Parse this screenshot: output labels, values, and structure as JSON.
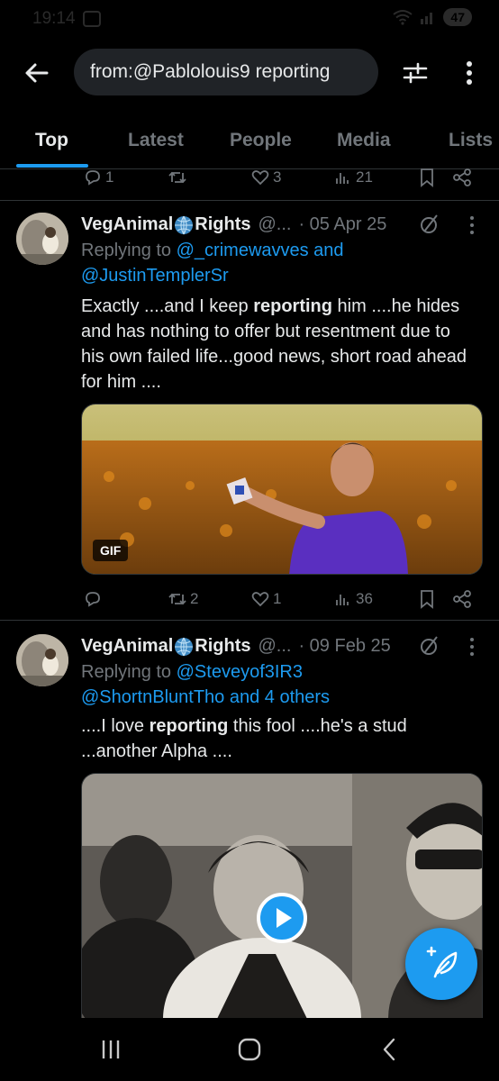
{
  "status": {
    "time": "19:14",
    "battery": "47"
  },
  "search": {
    "query": "from:@Pablolouis9 reporting"
  },
  "tabs": [
    {
      "label": "Top",
      "active": true
    },
    {
      "label": "Latest",
      "active": false
    },
    {
      "label": "People",
      "active": false
    },
    {
      "label": "Media",
      "active": false
    },
    {
      "label": "Lists",
      "active": false
    }
  ],
  "prev_tweet_actions": {
    "replies": "1",
    "retweets": "",
    "likes": "3",
    "views": "21"
  },
  "tweets": [
    {
      "name": "VegAnimal",
      "name_suffix": "Rights",
      "handle": "@...",
      "date": "· 05 Apr 25",
      "reply_prefix": "Replying to ",
      "reply_users": "@_crimewavves and @JustinTemplerSr",
      "text_before": "Exactly ....and I keep ",
      "text_bold": "reporting",
      "text_after": " him ....he hides and has nothing to offer but resentment due to his own failed life...good news, short road ahead for him ....",
      "media_badge": "GIF",
      "replies": "",
      "retweets": "2",
      "likes": "1",
      "views": "36"
    },
    {
      "name": "VegAnimal",
      "name_suffix": "Rights",
      "handle": "@...",
      "date": "· 09 Feb 25",
      "reply_prefix": "Replying to ",
      "reply_user1": "@Steveyof3IR3",
      "reply_user2": "@ShortnBluntTho and 4 others",
      "text_before": "....I love ",
      "text_bold": "reporting",
      "text_after": " this fool ....he's a stud ...another Alpha ...."
    }
  ],
  "colors": {
    "accent": "#1d9bf0",
    "muted": "#71767b",
    "text": "#e7e9ea",
    "bg": "#000000"
  }
}
